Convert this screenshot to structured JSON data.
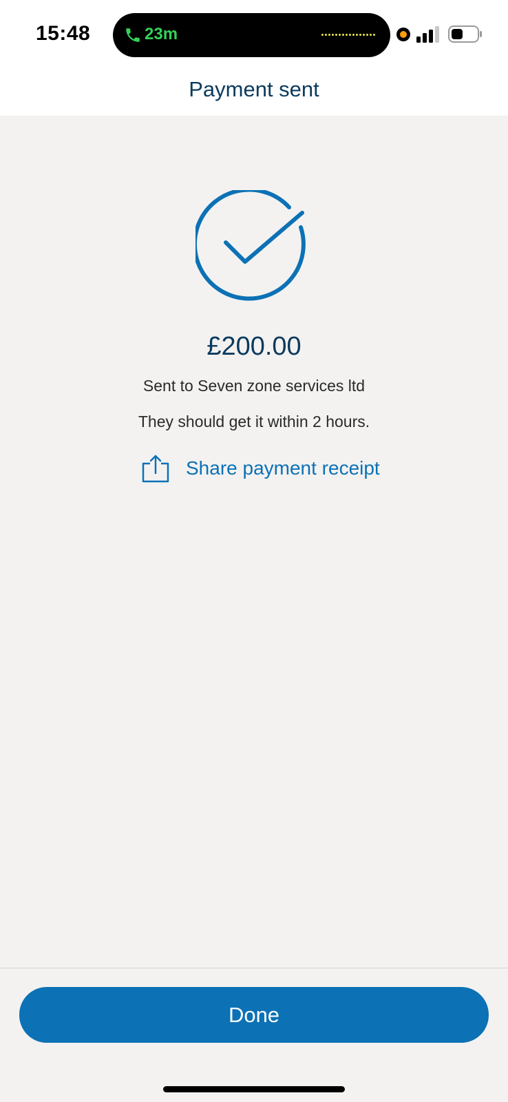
{
  "status_bar": {
    "time": "15:48",
    "call_duration": "23m",
    "icons": [
      "phone-icon",
      "audio-wave-icon",
      "recording-dot-icon",
      "cellular-signal-icon",
      "battery-icon"
    ]
  },
  "header": {
    "title": "Payment sent"
  },
  "confirmation": {
    "icon": "checkmark-circle-icon",
    "amount": "£200.00",
    "recipient_text": "Sent to Seven zone services ltd",
    "eta_text": "They should get it within 2 hours.",
    "share_label": "Share payment receipt",
    "share_icon": "share-icon"
  },
  "footer": {
    "done_label": "Done"
  },
  "colors": {
    "brand_blue": "#0c71b5",
    "title_navy": "#0b3a5d",
    "background": "#f3f2f1",
    "call_green": "#34d158",
    "recording_orange": "#ff9f0a"
  }
}
